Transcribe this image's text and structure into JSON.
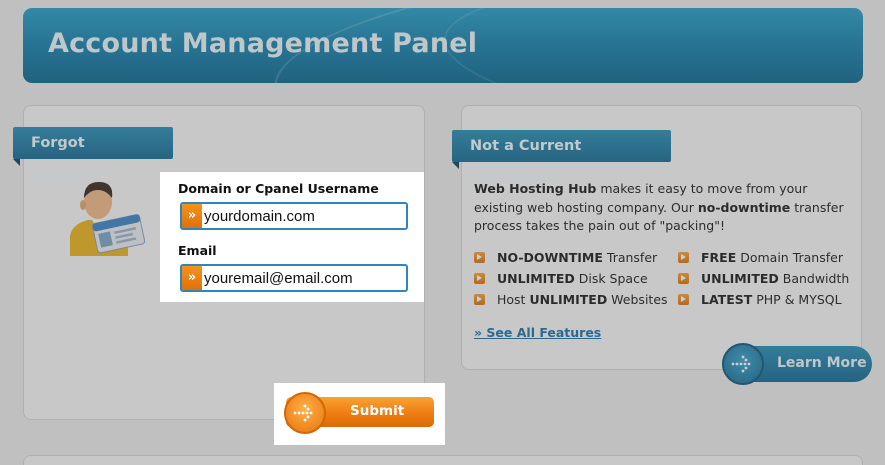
{
  "header": {
    "title": "Account Management Panel"
  },
  "forgot": {
    "tab_label": "Forgot Password",
    "username_label": "Domain or Cpanel Username",
    "username_value": "yourdomain.com",
    "email_label": "Email",
    "email_value": "youremail@email.com",
    "badge_glyph": "»",
    "submit_label": "Submit"
  },
  "customer": {
    "tab_label": "Not a Current Customer?",
    "intro_brand": "Web Hosting Hub",
    "intro_part1": " makes it easy to move from your existing web hosting company. Our ",
    "intro_bold": "no-downtime",
    "intro_part2": " transfer process takes the pain out of \"packing\"!",
    "features": [
      {
        "bold_prefix": "",
        "bold": "NO-DOWNTIME",
        "text": " Transfer"
      },
      {
        "bold_prefix": "",
        "bold": "FREE",
        "text": " Domain Transfer"
      },
      {
        "bold_prefix": "",
        "bold": "UNLIMITED",
        "text": " Disk Space"
      },
      {
        "bold_prefix": "",
        "bold": "UNLIMITED",
        "text": " Bandwidth"
      },
      {
        "bold_prefix": "Host ",
        "bold": "UNLIMITED",
        "text": " Websites"
      },
      {
        "bold_prefix": "",
        "bold": "LATEST",
        "text": " PHP & MYSQL"
      }
    ],
    "see_all_label": "» See All Features",
    "learn_more_label": "Learn More"
  },
  "colors": {
    "header_blue": "#1a84b0",
    "accent_orange": "#ee7d12",
    "link_blue": "#1f74a8",
    "field_border": "#2f86bd"
  },
  "icons": {
    "avatar": "user-with-id-card-icon",
    "arrow": "dotted-arrow-icon"
  }
}
